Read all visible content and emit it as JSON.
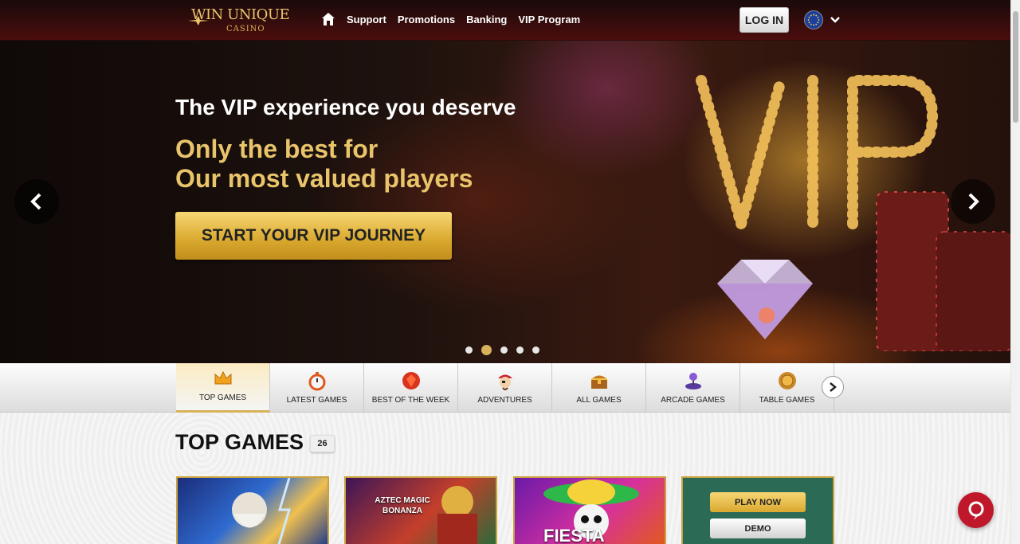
{
  "brand": {
    "name": "WIN UNIQUE",
    "subtitle": "CASINO"
  },
  "nav": {
    "items": [
      "Support",
      "Promotions",
      "Banking",
      "VIP Program"
    ]
  },
  "header": {
    "login_label": "LOG IN",
    "language_icon": "eu-flag-icon"
  },
  "hero": {
    "title": "The VIP experience you deserve",
    "subtitle_line1": "Only the best for",
    "subtitle_line2": "Our most valued players",
    "cta_label": "START YOUR VIP JOURNEY",
    "slides_total": 5,
    "active_slide": 2,
    "accent_color": "#e9c46a"
  },
  "categories": [
    {
      "label": "TOP GAMES",
      "icon": "crown-icon",
      "active": true
    },
    {
      "label": "LATEST GAMES",
      "icon": "stopwatch-icon",
      "active": false
    },
    {
      "label": "BEST OF THE WEEK",
      "icon": "gem-icon",
      "active": false
    },
    {
      "label": "ADVENTURES",
      "icon": "pirate-icon",
      "active": false
    },
    {
      "label": "ALL GAMES",
      "icon": "treasure-chest-icon",
      "active": false
    },
    {
      "label": "ARCADE GAMES",
      "icon": "joystick-icon",
      "active": false
    },
    {
      "label": "TABLE GAMES",
      "icon": "coin-icon",
      "active": false
    }
  ],
  "section": {
    "title": "TOP GAMES",
    "count": "26"
  },
  "games": [
    {
      "name": "zeus-game-thumbnail"
    },
    {
      "name": "aztec-magic-bonanza-thumbnail",
      "label_line1": "AZTEC MAGIC",
      "label_line2": "BONANZA"
    },
    {
      "name": "fiesta-game-thumbnail",
      "label": "FIESTA"
    },
    {
      "name": "hovered-game-thumbnail",
      "play_label": "PLAY NOW",
      "demo_label": "DEMO"
    }
  ]
}
